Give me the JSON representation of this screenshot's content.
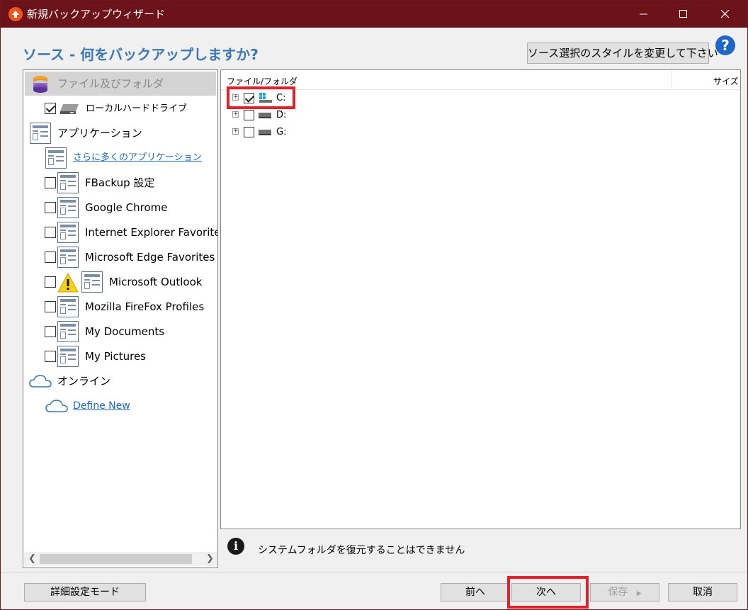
{
  "window": {
    "title": "新規バックアップウィザード",
    "controls": [
      "minimize",
      "maximize",
      "close"
    ]
  },
  "header": {
    "heading": "ソース - 何をバックアップしますか?",
    "style_button": "ソース選択のスタイルを変更して下さい",
    "help": "?"
  },
  "sidebar": {
    "files_section": "ファイル及びフォルダ",
    "local_drive": {
      "label": "ローカルハードドライブ",
      "checked": true
    },
    "applications_section": "アプリケーション",
    "more_apps_link": "さらに多くのアプリケーション",
    "apps": [
      {
        "label": "FBackup 設定",
        "checked": false
      },
      {
        "label": "Google Chrome",
        "checked": false
      },
      {
        "label": "Internet Explorer Favorites",
        "checked": false
      },
      {
        "label": "Microsoft Edge Favorites",
        "checked": false
      },
      {
        "label": "Microsoft Outlook",
        "checked": false,
        "warning": true
      },
      {
        "label": "Mozilla FireFox Profiles",
        "checked": false
      },
      {
        "label": "My Documents",
        "checked": false
      },
      {
        "label": "My Pictures",
        "checked": false
      }
    ],
    "online_section": "オンライン",
    "define_new_link": "Define New"
  },
  "file_tree": {
    "col_name": "ファイル/フォルダ",
    "col_size": "サイズ",
    "drives": [
      {
        "label": "C:",
        "checked": true,
        "highlighted": true
      },
      {
        "label": "D:",
        "checked": false
      },
      {
        "label": "G:",
        "checked": false
      }
    ]
  },
  "info": {
    "message": "システムフォルダを復元することはできません"
  },
  "footer": {
    "advanced_mode": "詳細設定モード",
    "back": "前へ",
    "next": "次へ",
    "save": "保存",
    "save_arrow": "▶",
    "cancel": "取消"
  },
  "colors": {
    "titlebar": "#6b1319",
    "accent_heading": "#3b78b5",
    "highlight": "#e3212a",
    "link": "#1c69c3"
  }
}
